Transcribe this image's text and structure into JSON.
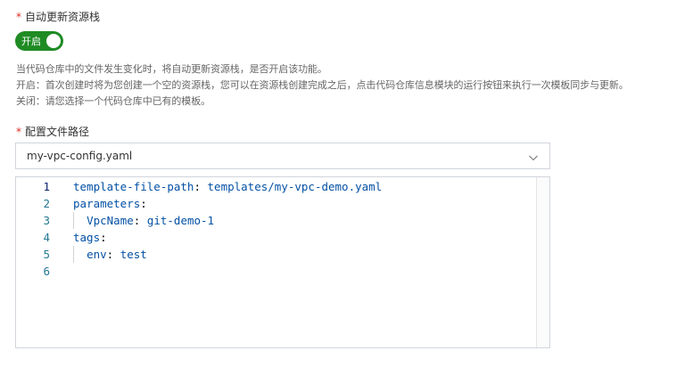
{
  "auto_update": {
    "label": "自动更新资源栈",
    "toggle_text": "开启",
    "enabled": true,
    "help_lines": [
      "当代码仓库中的文件发生变化时，将自动更新资源栈，是否开启该功能。",
      "开启：首次创建时将为您创建一个空的资源栈，您可以在资源栈创建完成之后，点击代码仓库信息模块的运行按钮来执行一次模板同步与更新。",
      "关闭：请您选择一个代码仓库中已有的模板。"
    ]
  },
  "config_path": {
    "label": "配置文件路径",
    "selected": "my-vpc-config.yaml"
  },
  "editor": {
    "lines": [
      {
        "num": "1",
        "key": "template-file-path",
        "sep": ": ",
        "value": "templates/my-vpc-demo.yaml",
        "indent": ""
      },
      {
        "num": "2",
        "key": "parameters",
        "sep": ":",
        "value": "",
        "indent": ""
      },
      {
        "num": "3",
        "key": "VpcName",
        "sep": ": ",
        "value": "git-demo-1",
        "indent": "  "
      },
      {
        "num": "4",
        "key": "tags",
        "sep": ":",
        "value": "",
        "indent": ""
      },
      {
        "num": "5",
        "key": "env",
        "sep": ": ",
        "value": "test",
        "indent": "  "
      },
      {
        "num": "6",
        "key": "",
        "sep": "",
        "value": "",
        "indent": ""
      }
    ]
  },
  "colors": {
    "toggle_on": "#1f8b24",
    "required": "#d93026",
    "yaml_key": "#0451a5",
    "line_number": "#237893"
  },
  "icons": {
    "select_caret": "chevron-down-icon"
  }
}
